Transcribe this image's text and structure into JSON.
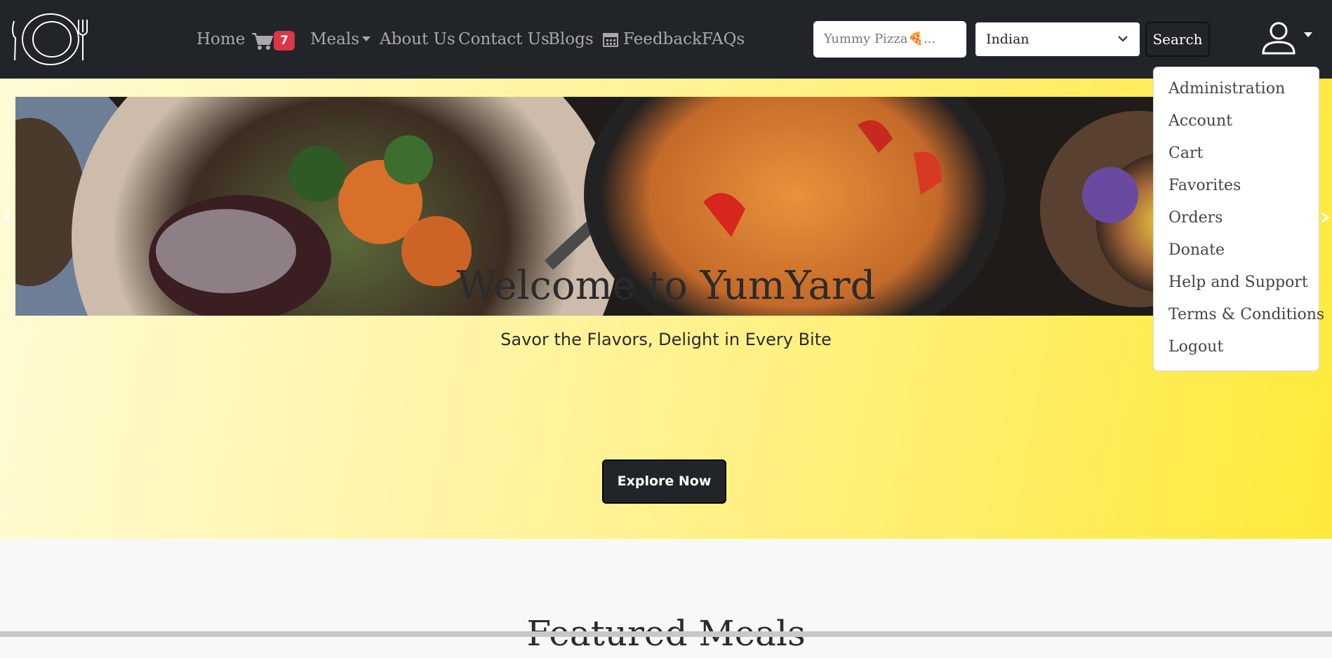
{
  "nav": {
    "links": {
      "home": "Home",
      "meals": "Meals",
      "about": "About Us",
      "contact": "Contact Us",
      "blogs": "Blogs",
      "feedback": "Feedback",
      "faqs": "FAQs"
    },
    "cart_count": "7",
    "search": {
      "placeholder": "Yummy Pizza🍕..."
    },
    "cuisine_select": {
      "selected": "Indian"
    },
    "search_button": "Search"
  },
  "user_menu": {
    "items": [
      "Administration",
      "Account",
      "Cart",
      "Favorites",
      "Orders",
      "Donate",
      "Help and Support",
      "Terms & Conditions",
      "Logout"
    ]
  },
  "hero": {
    "title": "Welcome to YumYard",
    "tagline": "Savor the Flavors, Delight in Every Bite",
    "cta": "Explore Now"
  },
  "featured": {
    "title": "Featured Meals"
  },
  "colors": {
    "navbar": "#212529",
    "badge": "#dc3545",
    "hero_gradient_start": "#fffbd6",
    "hero_gradient_end": "#ffe93a"
  },
  "icons": [
    "logo-plate-icon",
    "cart-icon",
    "calendar-icon",
    "chevron-down-icon",
    "user-icon",
    "carousel-prev-icon",
    "carousel-next-icon"
  ]
}
